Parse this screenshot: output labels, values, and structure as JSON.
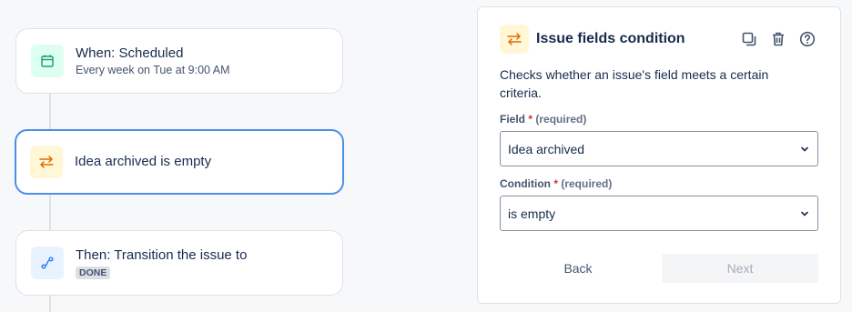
{
  "flow": {
    "trigger": {
      "title": "When: Scheduled",
      "subtitle": "Every week on Tue at 9:00 AM",
      "icon": "calendar-icon"
    },
    "condition": {
      "title": "Idea archived is empty",
      "icon": "swap-arrows-icon"
    },
    "action": {
      "title": "Then: Transition the issue to",
      "status": "DONE",
      "icon": "transition-icon"
    }
  },
  "panel": {
    "title": "Issue fields condition",
    "icon": "swap-arrows-icon",
    "description": "Checks whether an issue's field meets a certain criteria.",
    "actions": {
      "duplicate_icon": "duplicate-icon",
      "delete_icon": "trash-icon",
      "help_icon": "help-icon"
    },
    "field": {
      "label": "Field",
      "required_mark": "*",
      "required_note": "(required)",
      "value": "Idea archived"
    },
    "condition": {
      "label": "Condition",
      "required_mark": "*",
      "required_note": "(required)",
      "value": "is empty"
    },
    "buttons": {
      "back": "Back",
      "next": "Next"
    }
  },
  "colors": {
    "selected_border": "#4c8ee8",
    "orange_icon": "#e06c00",
    "green_icon": "#22a06b",
    "blue_icon": "#1d7afc"
  }
}
